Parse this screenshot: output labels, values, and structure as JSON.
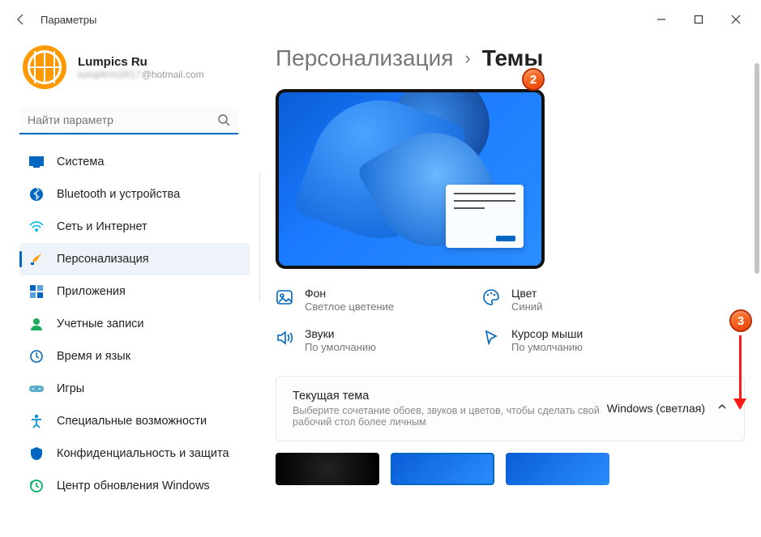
{
  "window": {
    "title": "Параметры"
  },
  "profile": {
    "name": "Lumpics Ru",
    "email_suffix": "@hotmail.com",
    "email_blur": "lumpfirm2017"
  },
  "search": {
    "placeholder": "Найти параметр"
  },
  "nav": {
    "items": [
      {
        "label": "Система"
      },
      {
        "label": "Bluetooth и устройства"
      },
      {
        "label": "Сеть и Интернет"
      },
      {
        "label": "Персонализация"
      },
      {
        "label": "Приложения"
      },
      {
        "label": "Учетные записи"
      },
      {
        "label": "Время и язык"
      },
      {
        "label": "Игры"
      },
      {
        "label": "Специальные возможности"
      },
      {
        "label": "Конфиденциальность и защита"
      },
      {
        "label": "Центр обновления Windows"
      }
    ]
  },
  "breadcrumb": {
    "parent": "Персонализация",
    "current": "Темы"
  },
  "props": {
    "background": {
      "label": "Фон",
      "value": "Светлое цветение"
    },
    "color": {
      "label": "Цвет",
      "value": "Синий"
    },
    "sounds": {
      "label": "Звуки",
      "value": "По умолчанию"
    },
    "cursor": {
      "label": "Курсор мыши",
      "value": "По умолчанию"
    }
  },
  "current_theme": {
    "heading": "Текущая тема",
    "sub": "Выберите сочетание обоев, звуков и цветов, чтобы сделать свой рабочий стол более личным",
    "value": "Windows (светлая)"
  },
  "annotations": {
    "b2": "2",
    "b3": "3"
  }
}
